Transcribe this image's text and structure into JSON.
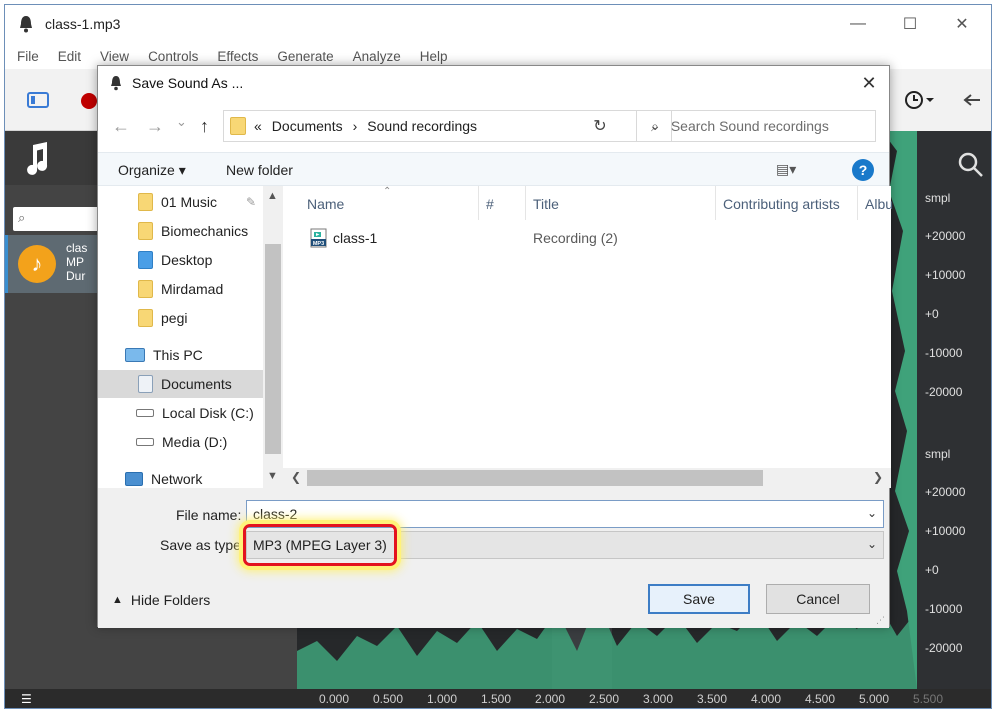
{
  "app": {
    "title": "class-1.mp3",
    "menu": [
      "File",
      "Edit",
      "View",
      "Controls",
      "Effects",
      "Generate",
      "Analyze",
      "Help"
    ],
    "window_controls": {
      "minimize": "—",
      "maximize": "☐",
      "close": "✕"
    },
    "file_item": {
      "line1": "clas",
      "line2": "MP",
      "line3": "Dur"
    },
    "scale_labels_top": [
      "smpl",
      "+20000",
      "+10000",
      "+0",
      "-10000",
      "-20000"
    ],
    "scale_labels_bottom": [
      "smpl",
      "+20000",
      "+10000",
      "+0",
      "-10000",
      "-20000"
    ],
    "timeline": [
      "0.000",
      "0.500",
      "1.000",
      "1.500",
      "2.000",
      "2.500",
      "3.000",
      "3.500",
      "4.000",
      "4.500",
      "5.000",
      "5.500"
    ]
  },
  "dialog": {
    "title": "Save Sound As ...",
    "close_glyph": "✕",
    "nav": {
      "back": "←",
      "forward": "→",
      "recent": "⌄",
      "up": "↑"
    },
    "address": {
      "prefix": "«",
      "crumbs": [
        "Documents",
        "›",
        "Sound recordings"
      ],
      "dropdown": "⌄"
    },
    "refresh": "↻",
    "search_placeholder": "Search Sound recordings",
    "organize_label": "Organize ▾",
    "new_folder_label": "New folder",
    "help_label": "?",
    "view_label": "▤▾",
    "nav_items": [
      {
        "label": "01 Music",
        "icon": "folder-icon"
      },
      {
        "label": "Biomechanics",
        "icon": "folder-icon"
      },
      {
        "label": "Desktop",
        "icon": "desktop-folder-icon"
      },
      {
        "label": "Mirdamad",
        "icon": "folder-icon"
      },
      {
        "label": "pegi",
        "icon": "folder-icon"
      },
      {
        "label": "This PC",
        "icon": "computer-icon"
      },
      {
        "label": "Documents",
        "icon": "documents-icon"
      },
      {
        "label": "Local Disk (C:)",
        "icon": "drive-icon"
      },
      {
        "label": "Media (D:)",
        "icon": "drive-icon"
      },
      {
        "label": "Network",
        "icon": "network-icon"
      }
    ],
    "columns": [
      "Name",
      "#",
      "Title",
      "Contributing artists",
      "Albu"
    ],
    "files": [
      {
        "name": "class-1",
        "title": "Recording (2)"
      }
    ],
    "file_name_label": "File name:",
    "file_name_value": "class-2",
    "save_as_type_label": "Save as type:",
    "save_as_type_value": "MP3 (MPEG Layer 3)",
    "hide_folders_label": "Hide Folders",
    "save_label": "Save",
    "cancel_label": "Cancel"
  },
  "colors": {
    "highlight_border": "#e3131f",
    "highlight_glow": "#fff27a",
    "wave": "#3fa27a",
    "accent": "#1979ca"
  }
}
